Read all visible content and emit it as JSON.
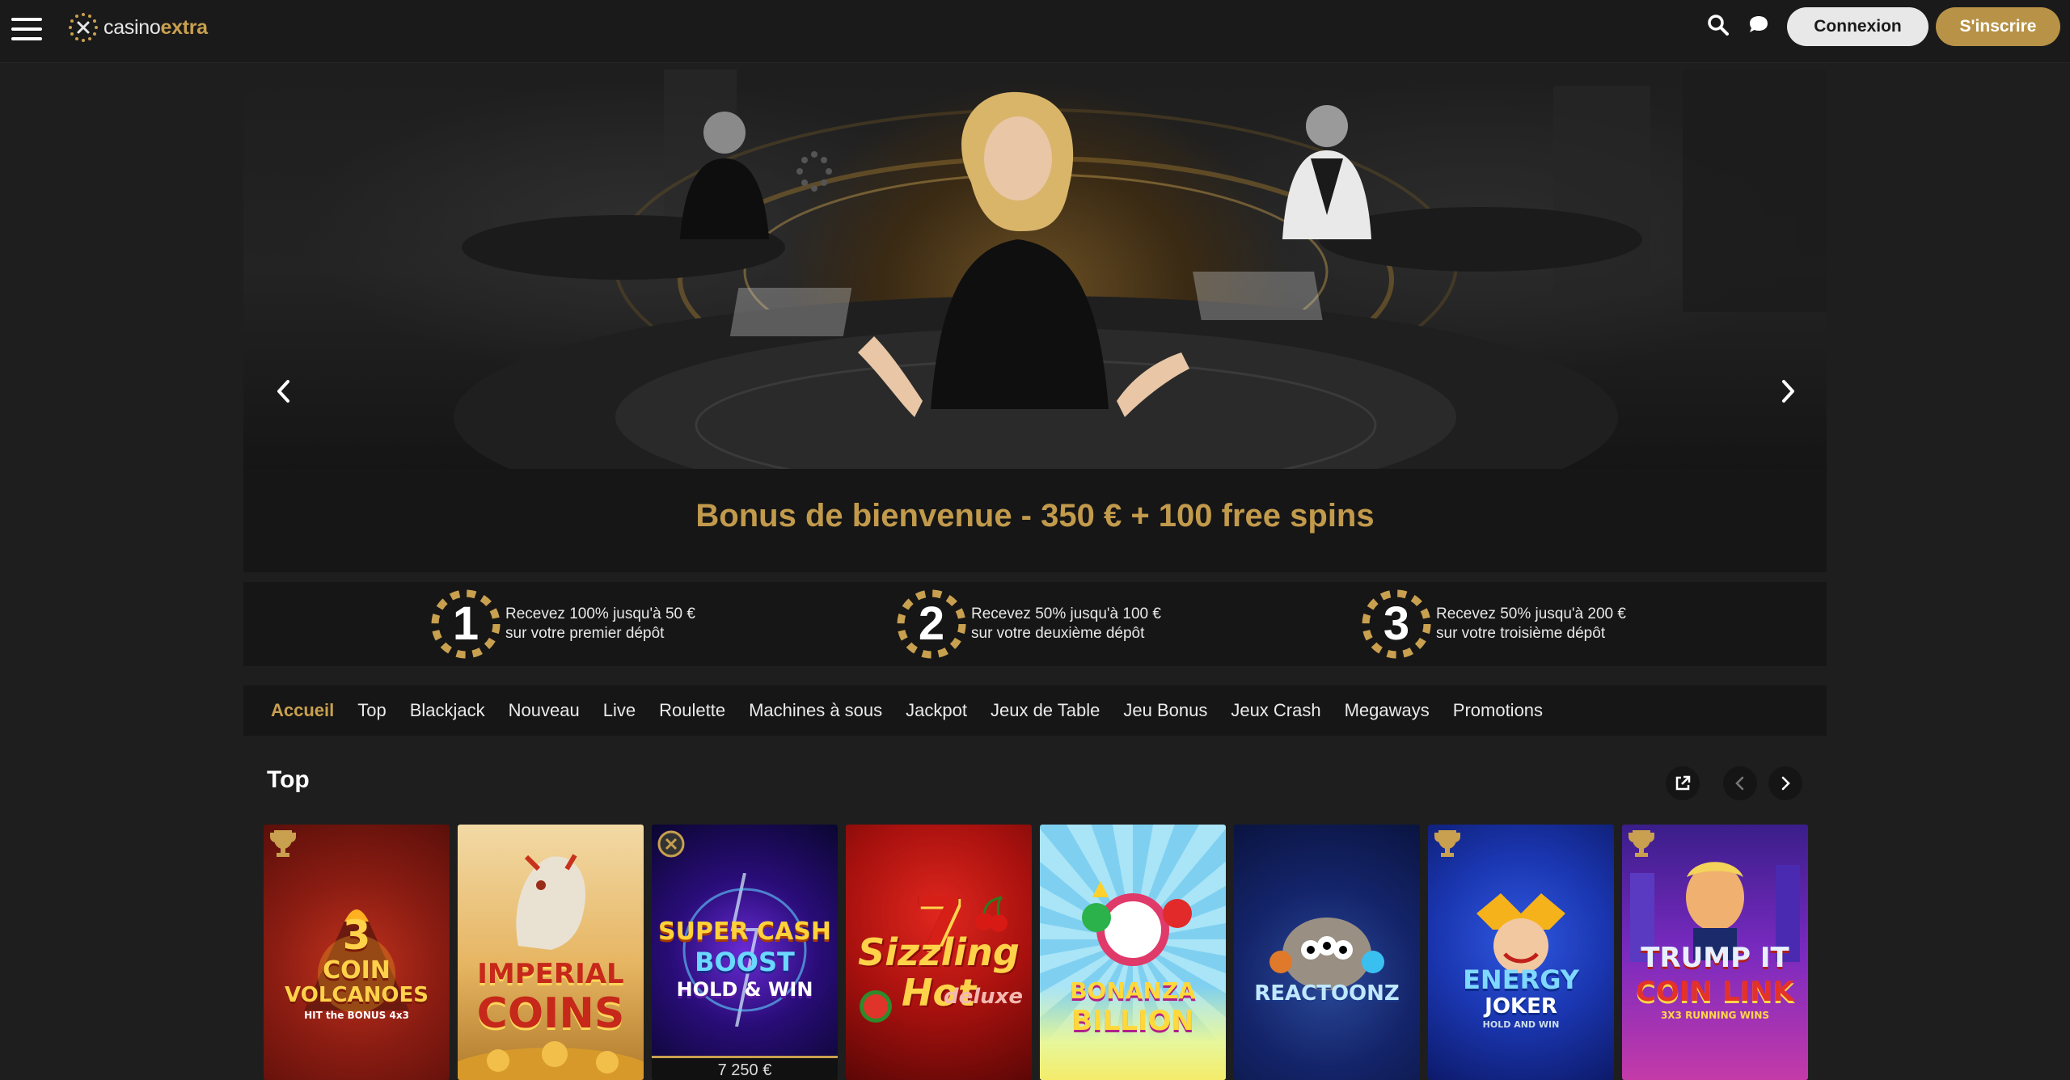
{
  "header": {
    "logo_part1": "casino",
    "logo_part2": "extra",
    "login_label": "Connexion",
    "signup_label": "S'inscrire"
  },
  "hero": {
    "promo_title": "Bonus de bienvenue - 350 € + 100 free spins"
  },
  "steps": [
    {
      "number": "1",
      "line1": "Recevez 100% jusqu'à 50 €",
      "line2": "sur votre premier dépôt"
    },
    {
      "number": "2",
      "line1": "Recevez 50% jusqu'à 100 €",
      "line2": "sur votre deuxième dépôt"
    },
    {
      "number": "3",
      "line1": "Recevez 50% jusqu'à 200 €",
      "line2": "sur votre troisième dépôt"
    }
  ],
  "nav": {
    "items": [
      "Accueil",
      "Top",
      "Blackjack",
      "Nouveau",
      "Live",
      "Roulette",
      "Machines à sous",
      "Jackpot",
      "Jeux de Table",
      "Jeu Bonus",
      "Jeux Crash",
      "Megaways",
      "Promotions"
    ],
    "active": "Accueil"
  },
  "section": {
    "title": "Top"
  },
  "games": [
    {
      "line1": "3",
      "line2": "COIN",
      "line3": "VOLCANOES",
      "line4": "HIT the BONUS 4x3"
    },
    {
      "line1": "IMPERIAL",
      "line2": "COINS"
    },
    {
      "line1": "SUPER CASH",
      "line2": "BOOST",
      "line3": "HOLD & WIN",
      "jackpot": "7 250 €"
    },
    {
      "line1": "7",
      "line2": "Sizzling",
      "line3": "Hot",
      "line4": "deluxe"
    },
    {
      "line1": "BONANZA",
      "line2": "BILLION"
    },
    {
      "line1": "REACTOONZ"
    },
    {
      "line1": "ENERGY",
      "line2": "JOKER",
      "line3": "HOLD AND WIN"
    },
    {
      "line1": "TRUMP IT",
      "line2": "COIN LINK",
      "line3": "3X3 RUNNING WINS"
    }
  ],
  "colors": {
    "accent": "#c8a04f",
    "background": "#1e1e1e",
    "panel": "#161616"
  },
  "icons": {
    "menu": "hamburger-icon",
    "search": "search-icon",
    "chat": "chat-icon",
    "prev": "chevron-left-icon",
    "next": "chevron-right-icon",
    "external": "external-link-icon",
    "trophy": "trophy-icon"
  }
}
